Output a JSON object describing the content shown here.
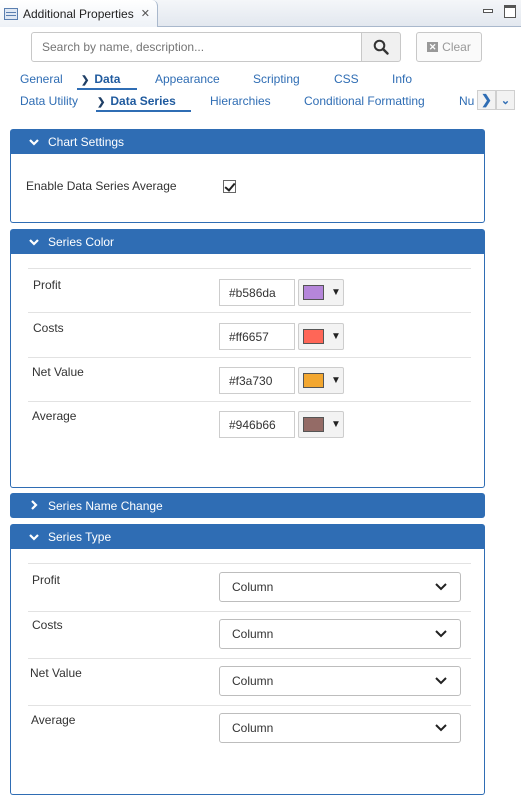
{
  "view": {
    "title": "Additional Properties",
    "close_icon": "close-icon"
  },
  "search": {
    "placeholder": "Search by name, description...",
    "clear_label": "Clear"
  },
  "tabs_row1": [
    {
      "label": "General",
      "active": false
    },
    {
      "label": "Data",
      "active": true
    },
    {
      "label": "Appearance",
      "active": false
    },
    {
      "label": "Scripting",
      "active": false
    },
    {
      "label": "CSS",
      "active": false
    },
    {
      "label": "Info",
      "active": false
    }
  ],
  "tabs_row2": [
    {
      "label": "Data Utility",
      "active": false
    },
    {
      "label": "Data Series",
      "active": true
    },
    {
      "label": "Hierarchies",
      "active": false
    },
    {
      "label": "Conditional Formatting",
      "active": false
    },
    {
      "label": "Nu",
      "active": false
    }
  ],
  "chart_settings": {
    "title": "Chart Settings",
    "enable_average_label": "Enable Data Series Average",
    "enable_average_checked": true
  },
  "series_color": {
    "title": "Series Color",
    "rows": [
      {
        "label": "Profit",
        "hex": "#b586da"
      },
      {
        "label": "Costs",
        "hex": "#ff6657"
      },
      {
        "label": "Net Value",
        "hex": "#f3a730"
      },
      {
        "label": "Average",
        "hex": "#946b66"
      }
    ]
  },
  "series_name_change": {
    "title": "Series Name Change",
    "expanded": false
  },
  "series_type": {
    "title": "Series Type",
    "rows": [
      {
        "label": "Profit",
        "value": "Column"
      },
      {
        "label": "Costs",
        "value": "Column"
      },
      {
        "label": "Net Value",
        "value": "Column"
      },
      {
        "label": "Average",
        "value": "Column"
      }
    ]
  },
  "colors": {
    "accent": "#2f6db4"
  }
}
